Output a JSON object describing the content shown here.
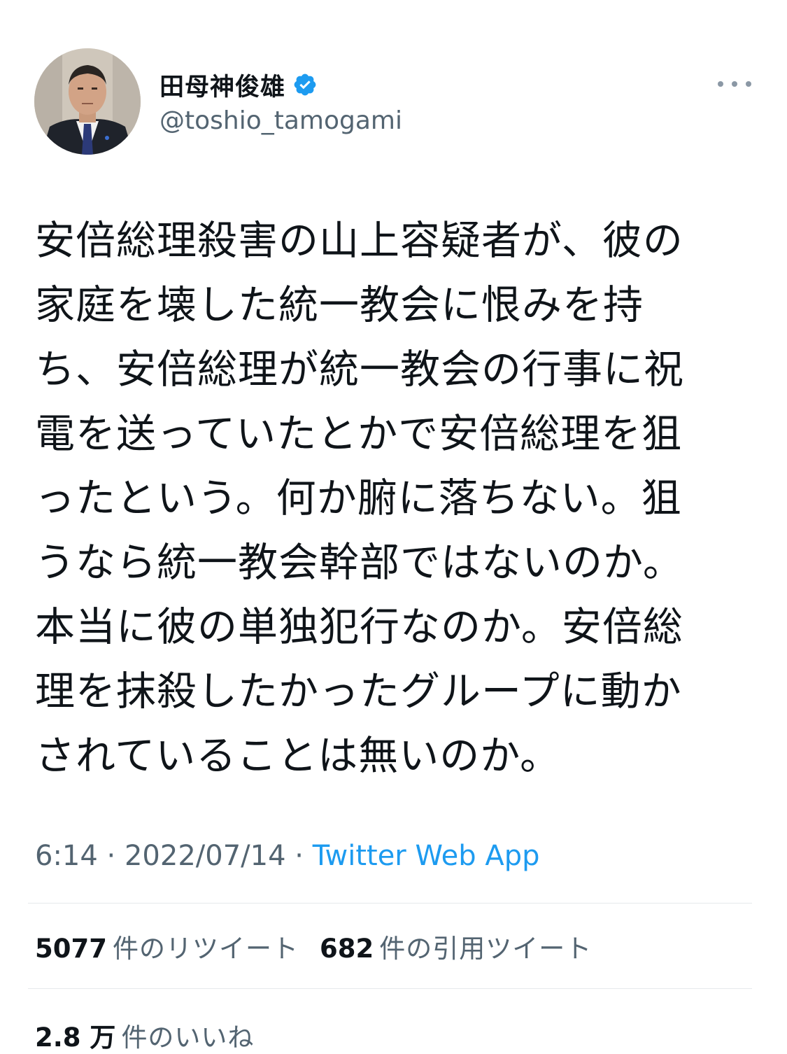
{
  "user": {
    "display_name": "田母神俊雄",
    "handle": "@toshio_tamogami",
    "verified": true
  },
  "tweet": {
    "lines": [
      "安倍総理殺害の山上容疑者が、彼の",
      "家庭を壊した統一教会に恨みを持",
      "ち、安倍総理が統一教会の行事に祝",
      "電を送っていたとかで安倍総理を狙",
      "ったという。何か腑に落ちない。狙",
      "うなら統一教会幹部ではないのか。",
      "本当に彼の単独犯行なのか。安倍総",
      "理を抹殺したかったグループに動か",
      "されていることは無いのか。"
    ],
    "time": "6:14",
    "separator": " · ",
    "date": "2022/07/14",
    "source": "Twitter Web App"
  },
  "stats": {
    "retweets_count": "5077",
    "retweets_label": "件のリツイート",
    "quotes_count": "682",
    "quotes_label": "件の引用ツイート",
    "likes_count": "2.8 万",
    "likes_label": "件のいいね"
  },
  "colors": {
    "text": "#0f1419",
    "secondary": "#536471",
    "link": "#1d9bf0",
    "verified": "#1d9bf0"
  },
  "icons": {
    "verified": "verified-badge-icon",
    "more": "more-horizontal-icon"
  }
}
